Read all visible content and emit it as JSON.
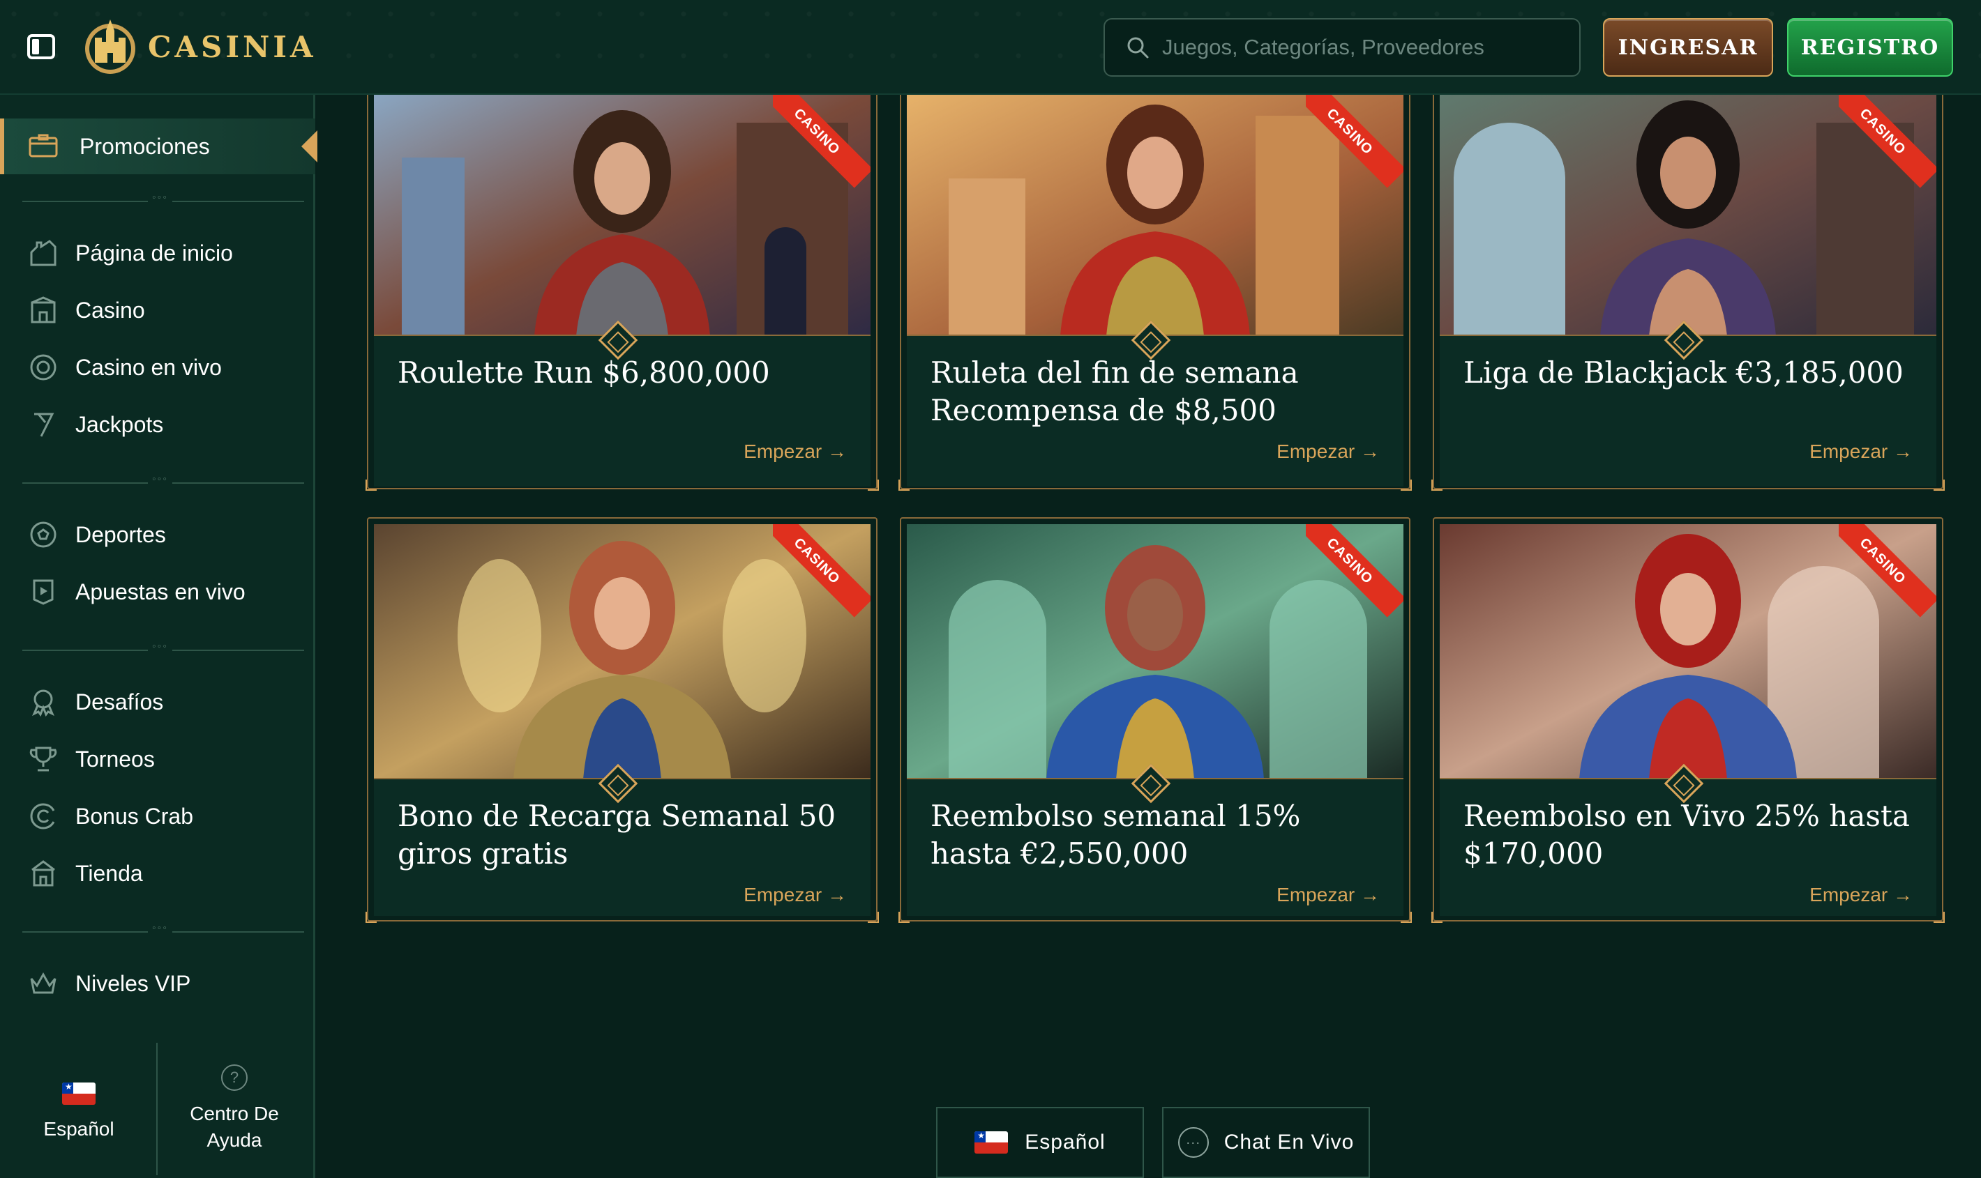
{
  "brand": {
    "name": "CASINIA",
    "accent": "#d9a55a",
    "green": "#23a24a"
  },
  "header": {
    "search_placeholder": "Juegos, Categorías, Proveedores",
    "login_label": "INGRESAR",
    "register_label": "REGISTRO"
  },
  "sidebar": {
    "active": {
      "label": "Promociones",
      "icon": "promotions-icon"
    },
    "group1": [
      {
        "label": "Página de inicio",
        "icon": "home-icon"
      },
      {
        "label": "Casino",
        "icon": "casino-icon"
      },
      {
        "label": "Casino en vivo",
        "icon": "live-casino-icon"
      },
      {
        "label": "Jackpots",
        "icon": "jackpot-icon"
      }
    ],
    "group2": [
      {
        "label": "Deportes",
        "icon": "sports-icon"
      },
      {
        "label": "Apuestas en vivo",
        "icon": "live-bets-icon"
      }
    ],
    "group3": [
      {
        "label": "Desafíos",
        "icon": "challenges-icon"
      },
      {
        "label": "Torneos",
        "icon": "trophy-icon"
      },
      {
        "label": "Bonus Crab",
        "icon": "bonus-crab-icon"
      },
      {
        "label": "Tienda",
        "icon": "shop-icon"
      }
    ],
    "group4": [
      {
        "label": "Niveles VIP",
        "icon": "crown-icon"
      }
    ],
    "footer": {
      "language": "Español",
      "help": "Centro De Ayuda"
    }
  },
  "promotions": [
    {
      "title": "Roulette Run $6,800,000",
      "cta": "Empezar →",
      "badge": "CASINO"
    },
    {
      "title": "Ruleta del fin de semana Recompensa de $8,500",
      "cta": "Empezar →",
      "badge": "CASINO"
    },
    {
      "title": "Liga de Blackjack €3,185,000",
      "cta": "Empezar →",
      "badge": "CASINO"
    },
    {
      "title": "Bono de Recarga Semanal 50 giros gratis",
      "cta": "Empezar →",
      "badge": "CASINO"
    },
    {
      "title": "Reembolso semanal 15% hasta €2,550,000",
      "cta": "Empezar →",
      "badge": "CASINO"
    },
    {
      "title": "Reembolso en Vivo 25% hasta $170,000",
      "cta": "Empezar →",
      "badge": "CASINO"
    }
  ],
  "bottom": {
    "language": "Español",
    "chat": "Chat En Vivo"
  }
}
